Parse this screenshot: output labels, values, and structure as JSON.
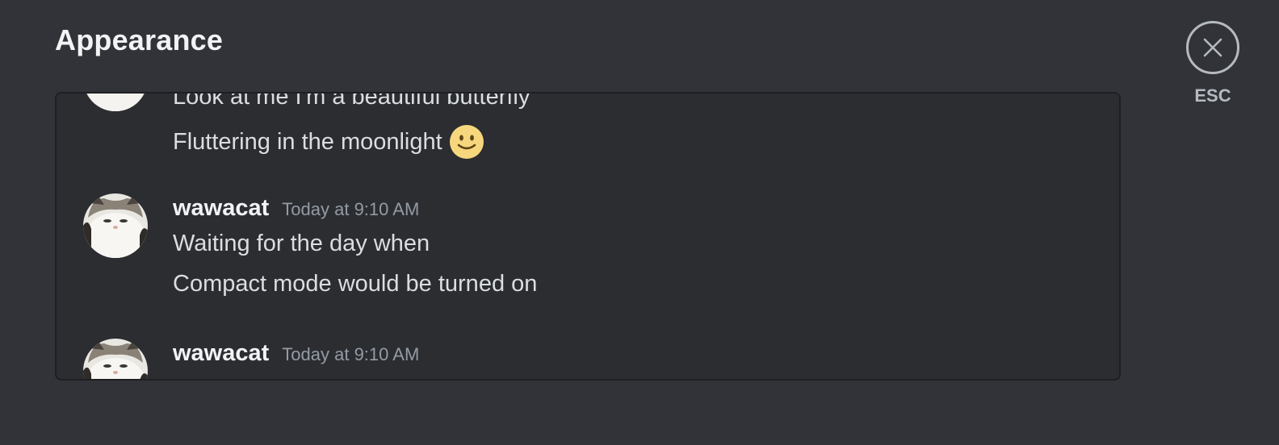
{
  "header": {
    "title": "Appearance",
    "close_label": "ESC",
    "close_icon": "close-icon"
  },
  "preview": {
    "partial_group": {
      "lines": [
        "Look at me I'm a beautiful butterfly",
        "Fluttering in the moonlight"
      ],
      "emoji": "slightly-smiling-face"
    },
    "messages": [
      {
        "username": "wawacat",
        "timestamp": "Today at 9:10 AM",
        "lines": [
          "Waiting for the day when",
          "Compact mode would be turned on"
        ]
      },
      {
        "username": "wawacat",
        "timestamp": "Today at 9:10 AM",
        "lines": []
      }
    ]
  },
  "colors": {
    "background": "#313338",
    "preview_background": "#2b2d31",
    "text_primary": "#f2f3f5",
    "text_normal": "#dbdee1",
    "text_muted": "#949ba4"
  }
}
